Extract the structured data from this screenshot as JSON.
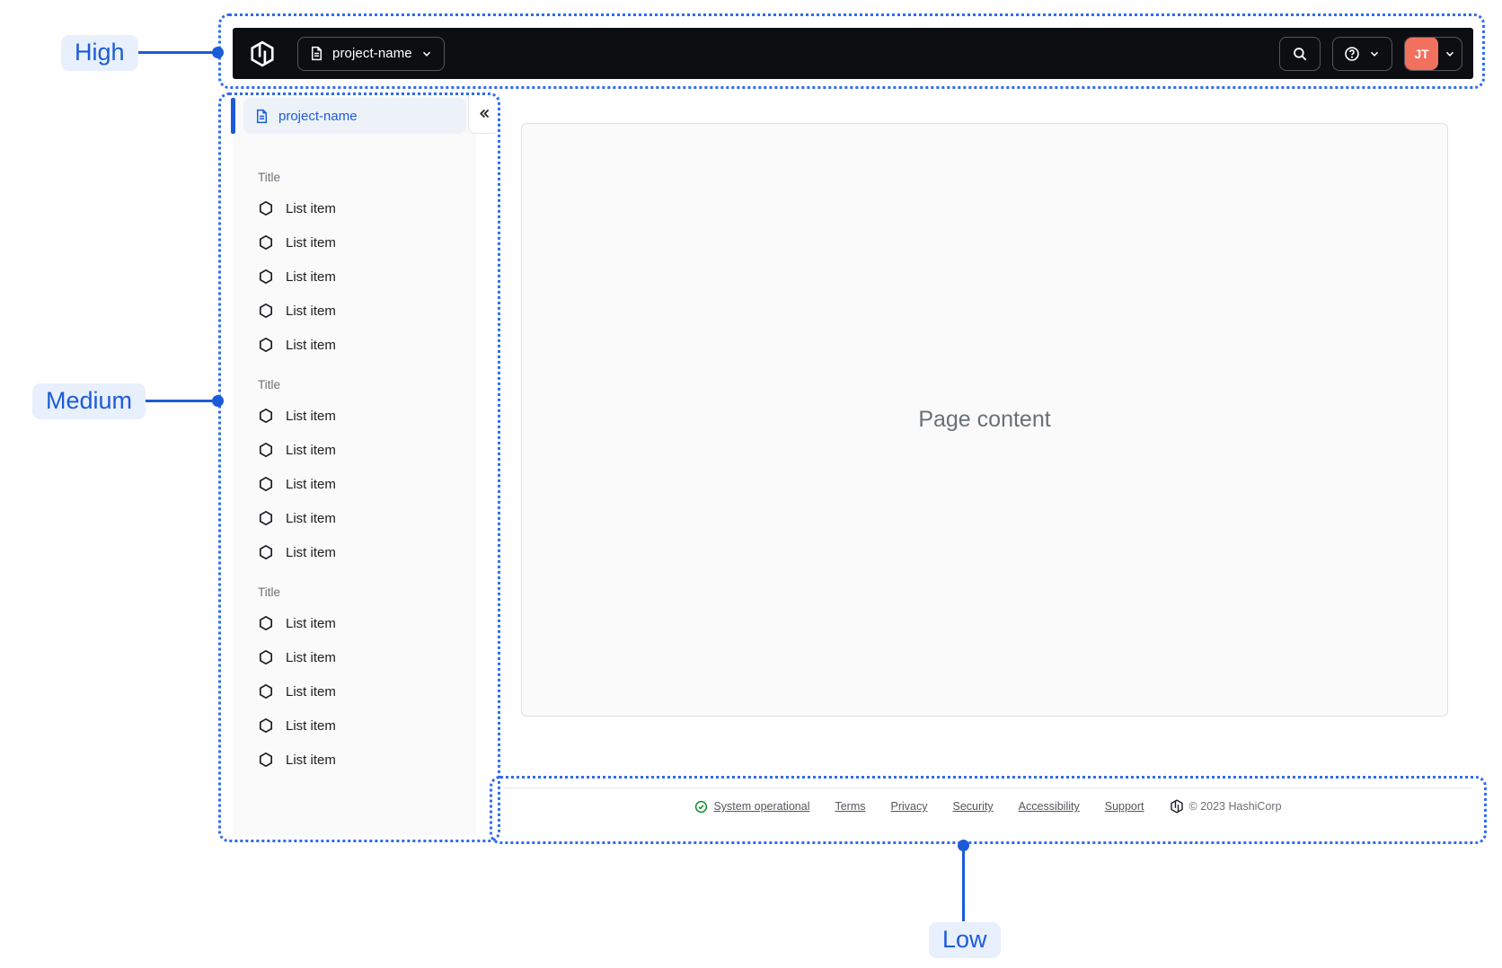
{
  "annotations": {
    "high": "High",
    "medium": "Medium",
    "low": "Low"
  },
  "navbar": {
    "project_switcher_label": "project-name",
    "avatar_initials": "JT"
  },
  "sidebar": {
    "project_label": "project-name",
    "sections": [
      {
        "title": "Title",
        "items": [
          "List item",
          "List item",
          "List item",
          "List item",
          "List item"
        ]
      },
      {
        "title": "Title",
        "items": [
          "List item",
          "List item",
          "List item",
          "List item",
          "List item"
        ]
      },
      {
        "title": "Title",
        "items": [
          "List item",
          "List item",
          "List item",
          "List item",
          "List item"
        ]
      }
    ]
  },
  "main": {
    "placeholder": "Page content"
  },
  "footer": {
    "status_label": "System operational",
    "links": [
      "Terms",
      "Privacy",
      "Security",
      "Accessibility",
      "Support"
    ],
    "copyright": "© 2023 HashiCorp"
  },
  "colors": {
    "annotation_blue": "#2e6bf0",
    "accent_blue": "#1c5bd8",
    "navbar_bg": "#0d0e12",
    "avatar_bg": "#f2705e",
    "success_green": "#008a22"
  }
}
